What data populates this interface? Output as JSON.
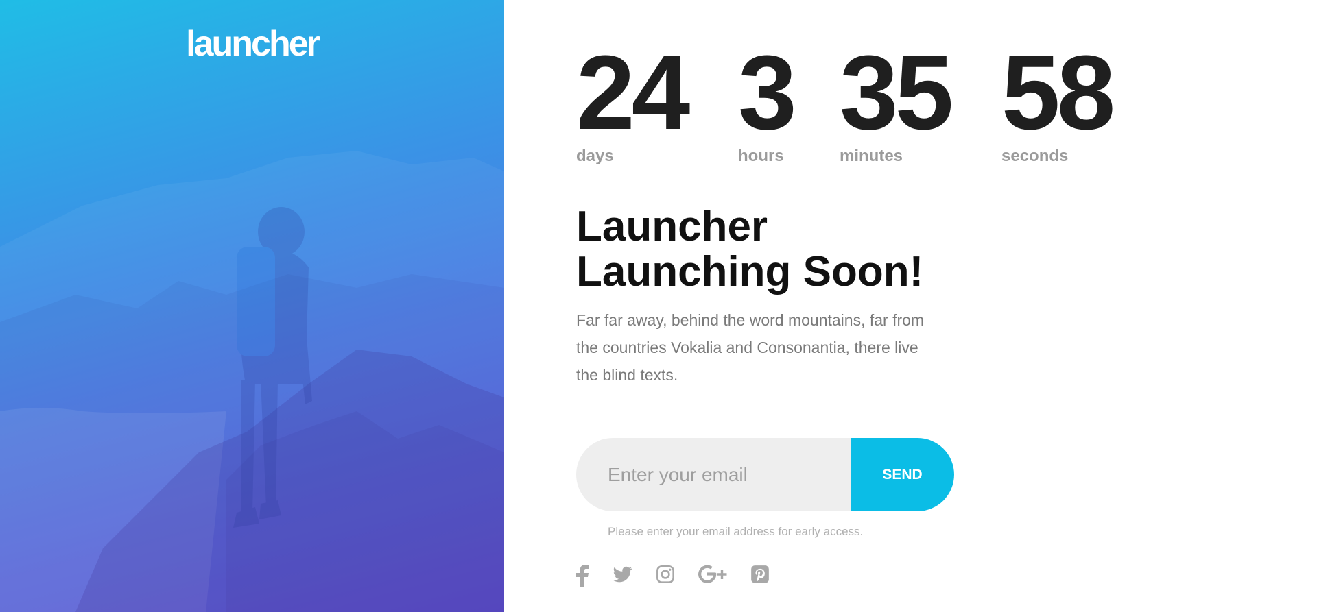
{
  "brand": {
    "logo_text": "launcher"
  },
  "countdown": [
    {
      "value": "24",
      "label": "days"
    },
    {
      "value": "3",
      "label": "hours"
    },
    {
      "value": "35",
      "label": "minutes"
    },
    {
      "value": "58",
      "label": "seconds"
    }
  ],
  "headline": {
    "line1": "Launcher",
    "line2": "Launching Soon!"
  },
  "description": "Far far away, behind the word mountains, far from the countries Vokalia and Consonantia, there live the blind texts.",
  "subscribe": {
    "placeholder": "Enter your email",
    "value": "",
    "button_label": "SEND",
    "hint": "Please enter your email address for early access."
  },
  "social": [
    {
      "icon": "facebook-icon"
    },
    {
      "icon": "twitter-icon"
    },
    {
      "icon": "instagram-icon"
    },
    {
      "icon": "google-plus-icon"
    },
    {
      "icon": "pinterest-icon"
    }
  ],
  "colors": {
    "accent": "#0bbde6",
    "gradient_top": "#20bde6",
    "gradient_bottom": "#5e4fd6",
    "countdown_text": "#1f1f1f",
    "label_text": "#9b9b9b",
    "body_text": "#7a7a7a",
    "icon_color": "#a8a8a8"
  }
}
